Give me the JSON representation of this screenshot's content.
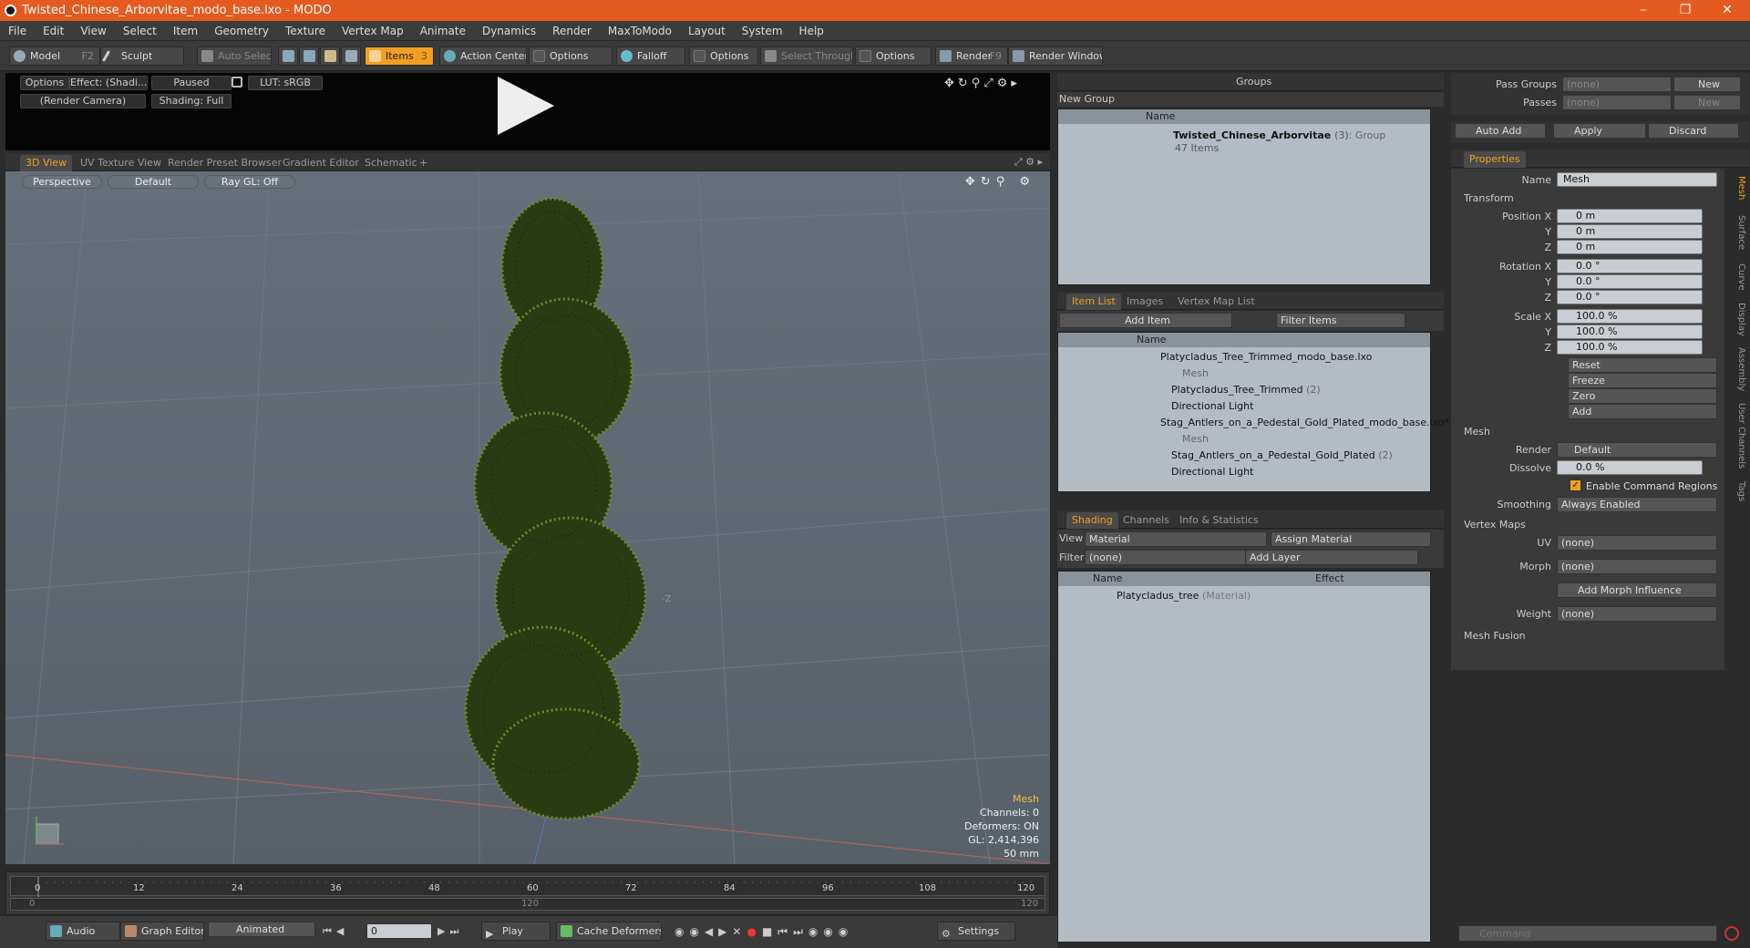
{
  "window": {
    "title": "Twisted_Chinese_Arborvitae_modo_base.lxo - MODO"
  },
  "menu": [
    "File",
    "Edit",
    "View",
    "Select",
    "Item",
    "Geometry",
    "Texture",
    "Vertex Map",
    "Animate",
    "Dynamics",
    "Render",
    "MaxToModo",
    "Layout",
    "System",
    "Help"
  ],
  "toolbar": {
    "model": "Model",
    "model_key": "F2",
    "sculpt": "Sculpt",
    "auto_select": "Auto Select",
    "items": "Items",
    "items_key": "3",
    "action_center": "Action Center",
    "options1": "Options",
    "falloff": "Falloff",
    "options2": "Options",
    "select_through": "Select Through",
    "options3": "Options",
    "render": "Render",
    "render_key": "F9",
    "render_window": "Render Window"
  },
  "preview": {
    "options": "Options",
    "effect": "Effect: (Shadi...",
    "paused": "Paused",
    "lut": "LUT: sRGB",
    "camera": "(Render Camera)",
    "shading": "Shading: Full"
  },
  "view_tabs": [
    "3D View",
    "UV Texture View",
    "Render Preset Browser",
    "Gradient Editor",
    "Schematic"
  ],
  "viewport": {
    "perspective": "Perspective",
    "default": "Default",
    "raygl": "Ray GL: Off",
    "axis_z": "-Z",
    "stats": {
      "title": "Mesh",
      "channels": "Channels: 0",
      "deformers": "Deformers: ON",
      "gl": "GL: 2,414,396",
      "unit": "50 mm"
    }
  },
  "timeline": {
    "ticks": [
      "0",
      "12",
      "24",
      "36",
      "48",
      "60",
      "72",
      "84",
      "96",
      "108",
      "120"
    ],
    "start": "0",
    "mid": "120",
    "end": "120"
  },
  "bottom": {
    "audio": "Audio",
    "graph_editor": "Graph Editor",
    "animated": "Animated",
    "frame": "0",
    "play": "Play",
    "cache_deformers": "Cache Deformers",
    "settings": "Settings"
  },
  "groups": {
    "title": "Groups",
    "new_group": "New Group",
    "col_name": "Name",
    "item_name": "Twisted_Chinese_Arborvitae",
    "item_count": "(3)",
    "item_type": ": Group",
    "item_sub": "47 Items"
  },
  "item_list": {
    "tabs": [
      "Item List",
      "Images",
      "Vertex Map List"
    ],
    "add_item": "Add Item",
    "filter": "Filter Items",
    "col_name": "Name",
    "rows": [
      "Platycladus_Tree_Trimmed_modo_base.lxo",
      "Mesh",
      "Platycladus_Tree_Trimmed",
      "Directional Light",
      "Stag_Antlers_on_a_Pedestal_Gold_Plated_modo_base.lxo*",
      "Mesh",
      "Stag_Antlers_on_a_Pedestal_Gold_Plated",
      "Directional Light"
    ],
    "counts": {
      "tree": "(2)",
      "stag": "(2)"
    }
  },
  "shading": {
    "tabs": [
      "Shading",
      "Channels",
      "Info & Statistics"
    ],
    "view_label": "View",
    "view_value": "Material",
    "assign": "Assign Material",
    "filter_label": "Filter",
    "filter_value": "(none)",
    "add_layer": "Add Layer",
    "col_name": "Name",
    "col_effect": "Effect",
    "row": "Platycladus_tree",
    "row_type": "(Material)"
  },
  "right_top": {
    "pass_groups": "Pass Groups",
    "pass_groups_val": "(none)",
    "new": "New",
    "passes": "Passes",
    "passes_val": "(none)",
    "new2": "New",
    "auto_add": "Auto Add",
    "apply": "Apply",
    "discard": "Discard"
  },
  "properties": {
    "tab": "Properties",
    "name_label": "Name",
    "name_val": "Mesh",
    "transform": "Transform",
    "pos_label": "Position X",
    "y": "Y",
    "z": "Z",
    "pos": [
      "0 m",
      "0 m",
      "0 m"
    ],
    "rot_label": "Rotation X",
    "rot": [
      "0.0 °",
      "0.0 °",
      "0.0 °"
    ],
    "scale_label": "Scale X",
    "scale": [
      "100.0 %",
      "100.0 %",
      "100.0 %"
    ],
    "reset": "Reset",
    "freeze": "Freeze",
    "zero": "Zero",
    "add": "Add",
    "mesh": "Mesh",
    "render_label": "Render",
    "render_val": "Default",
    "dissolve_label": "Dissolve",
    "dissolve_val": "0.0 %",
    "cmd_regions": "Enable Command Regions",
    "smoothing_label": "Smoothing",
    "smoothing_val": "Always Enabled",
    "vertex_maps": "Vertex Maps",
    "uv_label": "UV",
    "uv_val": "(none)",
    "morph_label": "Morph",
    "morph_val": "(none)",
    "add_morph": "Add Morph Influence",
    "weight_label": "Weight",
    "weight_val": "(none)",
    "mesh_fusion": "Mesh Fusion",
    "side_tabs": [
      "Mesh",
      "Surface",
      "Curve",
      "Display",
      "Assembly",
      "User Channels",
      "Tags"
    ]
  },
  "command": {
    "placeholder": "Command"
  },
  "colors": {
    "accent": "#f0a020",
    "title": "#e55a1f"
  }
}
